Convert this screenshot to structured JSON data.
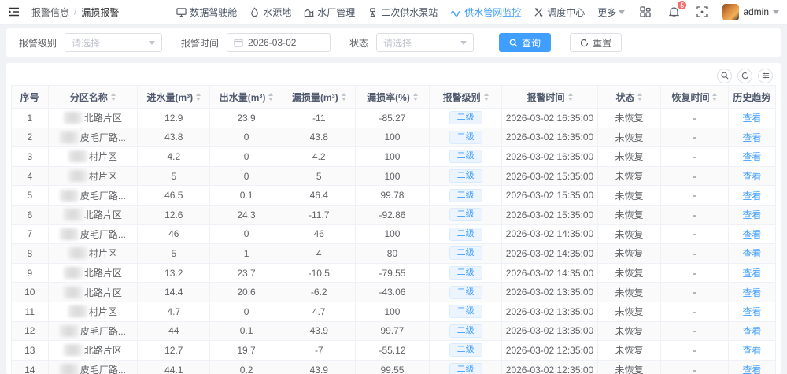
{
  "colors": {
    "accent": "#409eff",
    "badge_bg": "#ecf5ff",
    "badge_border": "#d9ecff",
    "danger": "#f56c6c",
    "page_bg": "#f0f2f5"
  },
  "topbar": {
    "breadcrumb": {
      "prev": "报警信息",
      "sep": "/",
      "current": "漏损报警"
    },
    "nav": [
      {
        "label": "数据驾驶舱",
        "icon": "dashboard-icon",
        "active": false
      },
      {
        "label": "水源地",
        "icon": "water-source-icon",
        "active": false
      },
      {
        "label": "水厂管理",
        "icon": "water-plant-icon",
        "active": false
      },
      {
        "label": "二次供水泵站",
        "icon": "pump-station-icon",
        "active": false
      },
      {
        "label": "供水管网监控",
        "icon": "pipe-network-icon",
        "active": true
      },
      {
        "label": "调度中心",
        "icon": "dispatch-center-icon",
        "active": false
      }
    ],
    "more_label": "更多",
    "notification_count": "5",
    "username": "admin"
  },
  "filters": {
    "level_label": "报警级别",
    "level_placeholder": "请选择",
    "time_label": "报警时间",
    "time_value": "2026-03-02",
    "status_label": "状态",
    "status_placeholder": "请选择",
    "search_button": "查询",
    "reset_button": "重置"
  },
  "table": {
    "columns": [
      {
        "key": "seq",
        "label": "序号",
        "sortable": false
      },
      {
        "key": "name",
        "label": "分区名称",
        "sortable": true
      },
      {
        "key": "inflow",
        "label": "进水量(m³)",
        "sortable": true
      },
      {
        "key": "outflow",
        "label": "出水量(m³)",
        "sortable": true
      },
      {
        "key": "loss",
        "label": "漏损量(m³)",
        "sortable": true
      },
      {
        "key": "rate",
        "label": "漏损率(%)",
        "sortable": true
      },
      {
        "key": "level",
        "label": "报警级别",
        "sortable": true
      },
      {
        "key": "time",
        "label": "报警时间",
        "sortable": true
      },
      {
        "key": "status",
        "label": "状态",
        "sortable": true
      },
      {
        "key": "recover",
        "label": "恢复时间",
        "sortable": true
      },
      {
        "key": "trend",
        "label": "历史趋势",
        "sortable": false
      }
    ],
    "rows": [
      {
        "seq": "1",
        "name": "北路片区",
        "inflow": "12.9",
        "outflow": "23.9",
        "loss": "-11",
        "rate": "-85.27",
        "level": "二级",
        "time": "2026-03-02 16:35:00",
        "status": "未恢复",
        "recover": "-",
        "trend": "查看"
      },
      {
        "seq": "2",
        "name": "皮毛厂路...",
        "inflow": "43.8",
        "outflow": "0",
        "loss": "43.8",
        "rate": "100",
        "level": "二级",
        "time": "2026-03-02 16:35:00",
        "status": "未恢复",
        "recover": "-",
        "trend": "查看"
      },
      {
        "seq": "3",
        "name": "村片区",
        "inflow": "4.2",
        "outflow": "0",
        "loss": "4.2",
        "rate": "100",
        "level": "二级",
        "time": "2026-03-02 16:35:00",
        "status": "未恢复",
        "recover": "-",
        "trend": "查看"
      },
      {
        "seq": "4",
        "name": "村片区",
        "inflow": "5",
        "outflow": "0",
        "loss": "5",
        "rate": "100",
        "level": "二级",
        "time": "2026-03-02 15:35:00",
        "status": "未恢复",
        "recover": "-",
        "trend": "查看"
      },
      {
        "seq": "5",
        "name": "皮毛厂路...",
        "inflow": "46.5",
        "outflow": "0.1",
        "loss": "46.4",
        "rate": "99.78",
        "level": "二级",
        "time": "2026-03-02 15:35:00",
        "status": "未恢复",
        "recover": "-",
        "trend": "查看"
      },
      {
        "seq": "6",
        "name": "北路片区",
        "inflow": "12.6",
        "outflow": "24.3",
        "loss": "-11.7",
        "rate": "-92.86",
        "level": "二级",
        "time": "2026-03-02 15:35:00",
        "status": "未恢复",
        "recover": "-",
        "trend": "查看"
      },
      {
        "seq": "7",
        "name": "皮毛厂路...",
        "inflow": "46",
        "outflow": "0",
        "loss": "46",
        "rate": "100",
        "level": "二级",
        "time": "2026-03-02 14:35:00",
        "status": "未恢复",
        "recover": "-",
        "trend": "查看"
      },
      {
        "seq": "8",
        "name": "村片区",
        "inflow": "5",
        "outflow": "1",
        "loss": "4",
        "rate": "80",
        "level": "二级",
        "time": "2026-03-02 14:35:00",
        "status": "未恢复",
        "recover": "-",
        "trend": "查看"
      },
      {
        "seq": "9",
        "name": "北路片区",
        "inflow": "13.2",
        "outflow": "23.7",
        "loss": "-10.5",
        "rate": "-79.55",
        "level": "二级",
        "time": "2026-03-02 14:35:00",
        "status": "未恢复",
        "recover": "-",
        "trend": "查看"
      },
      {
        "seq": "10",
        "name": "北路片区",
        "inflow": "14.4",
        "outflow": "20.6",
        "loss": "-6.2",
        "rate": "-43.06",
        "level": "二级",
        "time": "2026-03-02 13:35:00",
        "status": "未恢复",
        "recover": "-",
        "trend": "查看"
      },
      {
        "seq": "11",
        "name": "村片区",
        "inflow": "4.7",
        "outflow": "0",
        "loss": "4.7",
        "rate": "100",
        "level": "二级",
        "time": "2026-03-02 13:35:00",
        "status": "未恢复",
        "recover": "-",
        "trend": "查看"
      },
      {
        "seq": "12",
        "name": "皮毛厂路...",
        "inflow": "44",
        "outflow": "0.1",
        "loss": "43.9",
        "rate": "99.77",
        "level": "二级",
        "time": "2026-03-02 13:35:00",
        "status": "未恢复",
        "recover": "-",
        "trend": "查看"
      },
      {
        "seq": "13",
        "name": "北路片区",
        "inflow": "12.7",
        "outflow": "19.7",
        "loss": "-7",
        "rate": "-55.12",
        "level": "二级",
        "time": "2026-03-02 12:35:00",
        "status": "未恢复",
        "recover": "-",
        "trend": "查看"
      },
      {
        "seq": "14",
        "name": "皮毛厂路...",
        "inflow": "44.1",
        "outflow": "0.2",
        "loss": "43.9",
        "rate": "99.55",
        "level": "二级",
        "time": "2026-03-02 12:35:00",
        "status": "未恢复",
        "recover": "-",
        "trend": "查看"
      }
    ]
  }
}
